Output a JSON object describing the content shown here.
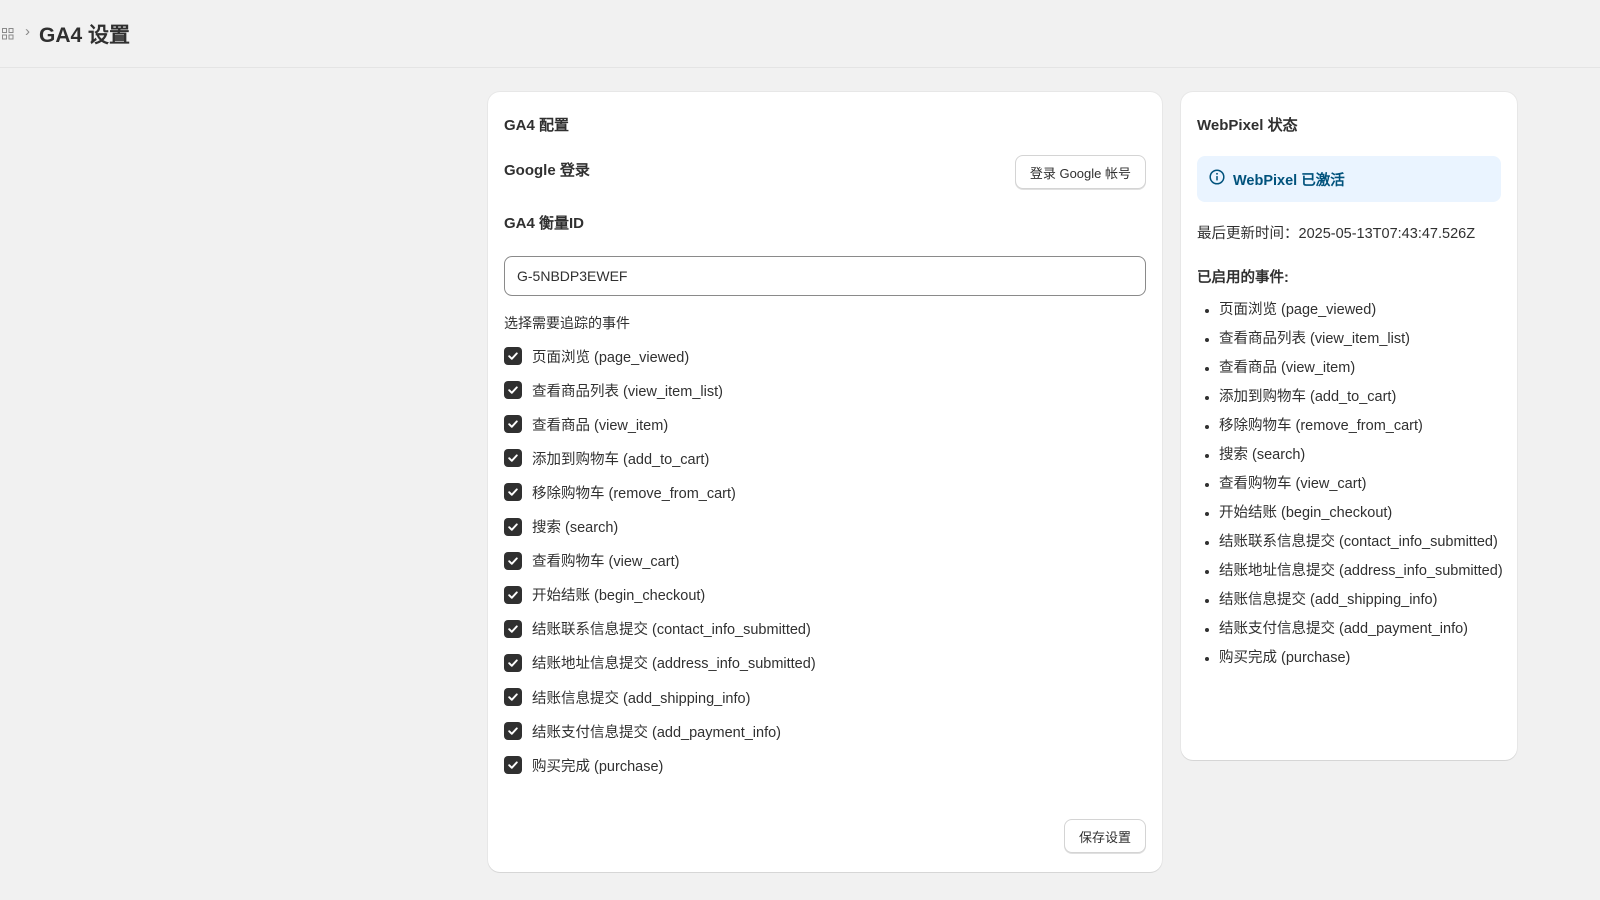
{
  "header": {
    "breadcrumb_separator": "›",
    "page_title": "GA4 设置"
  },
  "config": {
    "title": "GA4 配置",
    "google_login_label": "Google 登录",
    "google_login_button": "登录 Google 帐号",
    "measurement_id_label": "GA4 衡量ID",
    "measurement_id_value": "G-5NBDP3EWEF",
    "events_label": "选择需要追踪的事件",
    "events": [
      {
        "label": "页面浏览 (page_viewed)",
        "checked": true
      },
      {
        "label": "查看商品列表 (view_item_list)",
        "checked": true
      },
      {
        "label": "查看商品 (view_item)",
        "checked": true
      },
      {
        "label": "添加到购物车 (add_to_cart)",
        "checked": true
      },
      {
        "label": "移除购物车 (remove_from_cart)",
        "checked": true
      },
      {
        "label": "搜索 (search)",
        "checked": true
      },
      {
        "label": "查看购物车 (view_cart)",
        "checked": true
      },
      {
        "label": "开始结账 (begin_checkout)",
        "checked": true
      },
      {
        "label": "结账联系信息提交 (contact_info_submitted)",
        "checked": true
      },
      {
        "label": "结账地址信息提交 (address_info_submitted)",
        "checked": true
      },
      {
        "label": "结账信息提交 (add_shipping_info)",
        "checked": true
      },
      {
        "label": "结账支付信息提交 (add_payment_info)",
        "checked": true
      },
      {
        "label": "购买完成 (purchase)",
        "checked": true
      }
    ],
    "save_button": "保存设置"
  },
  "status": {
    "title": "WebPixel 状态",
    "banner_text": "WebPixel 已激活",
    "banner_icon": "info-icon",
    "last_updated": "最后更新时间：2025-05-13T07:43:47.526Z",
    "enabled_heading": "已启用的事件:",
    "enabled_events": [
      "页面浏览 (page_viewed)",
      "查看商品列表 (view_item_list)",
      "查看商品 (view_item)",
      "添加到购物车 (add_to_cart)",
      "移除购物车 (remove_from_cart)",
      "搜索 (search)",
      "查看购物车 (view_cart)",
      "开始结账 (begin_checkout)",
      "结账联系信息提交 (contact_info_submitted)",
      "结账地址信息提交 (address_info_submitted)",
      "结账信息提交 (add_shipping_info)",
      "结账支付信息提交 (add_payment_info)",
      "购买完成 (purchase)"
    ]
  },
  "colors": {
    "background": "#f1f1f1",
    "card": "#ffffff",
    "checkbox": "#303030",
    "banner_bg": "#eaf4ff",
    "banner_text": "#00527c"
  }
}
